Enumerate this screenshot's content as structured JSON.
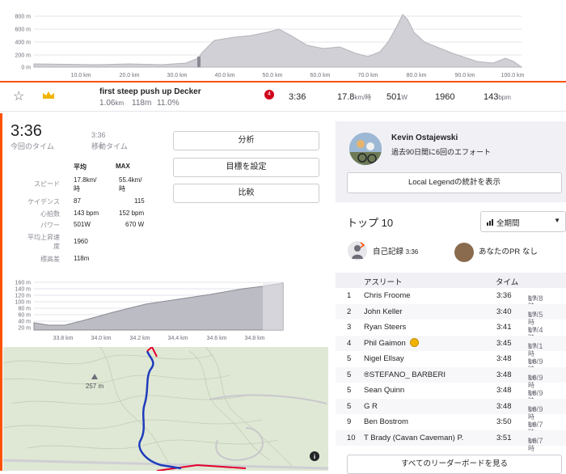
{
  "elevation_chart": {
    "y_ticks": [
      "800 m",
      "600 m",
      "400 m",
      "200 m",
      "0 m"
    ],
    "x_ticks": [
      "10.0 km",
      "20.0 km",
      "30.0 km",
      "40.0 km",
      "50.0 km",
      "60.0 km",
      "70.0 km",
      "80.0 km",
      "90.0 km",
      "100.0 km"
    ]
  },
  "segment": {
    "name": "first steep push up Decker",
    "distance": "1.06",
    "distance_unit": "km",
    "elev_gain": "118m",
    "grade": "11.0%",
    "badge": "4",
    "time": "3:36",
    "speed": "17.8",
    "speed_unit": "km/時",
    "power": "501",
    "power_unit": "W",
    "cadence": "1960",
    "heart_rate": "143",
    "heart_rate_unit": "bpm"
  },
  "effort": {
    "elapsed_time": "3:36",
    "elapsed_label": "今回のタイム",
    "moving_time": "3:36",
    "moving_label": "移動タイム",
    "buttons": [
      "分析",
      "目標を設定",
      "比較"
    ],
    "col_avg": "平均",
    "col_max": "MAX",
    "stats": [
      {
        "label": "スピード",
        "avg": "17.8km/ 時",
        "max": "55.4km/ 時"
      },
      {
        "label": "ケイデンス",
        "avg": "87",
        "max": "115"
      },
      {
        "label": "心拍数",
        "avg": "143 bpm",
        "max": "152 bpm"
      },
      {
        "label": "パワー",
        "avg": "501W",
        "max": "670 W"
      },
      {
        "label": "平均上昇速度",
        "avg": "1960",
        "max": ""
      },
      {
        "label": "標高差",
        "avg": "118m",
        "max": ""
      }
    ]
  },
  "profile_chart": {
    "y_ticks": [
      "160 m",
      "140 m",
      "120 m",
      "100 m",
      "80 m",
      "60 m",
      "40 m",
      "20 m"
    ],
    "x_ticks": [
      "33.8 km",
      "34.0 km",
      "34.2 km",
      "34.4 km",
      "34.6 km",
      "34.8 km"
    ]
  },
  "map": {
    "peak_label": "257 m",
    "info_icon": "i"
  },
  "local_legend": {
    "name": "Kevin Ostajewski",
    "text": "過去90日間に6回のエフォート",
    "button": "Local Legendの統計を表示"
  },
  "leaderboard": {
    "title": "トップ 10",
    "filter": "全期間",
    "pr_label": "自己記録",
    "pr_value": "3:36",
    "your_pr_label": "あなたのPR なし",
    "col_athlete": "アスリート",
    "col_time": "タイム",
    "rows": [
      {
        "rank": "1",
        "name": "Chris Froome",
        "time": "3:36",
        "speed": "17.8",
        "unit": "km/時"
      },
      {
        "rank": "2",
        "name": "John Keller",
        "time": "3:40",
        "speed": "17.5",
        "unit": "km/時"
      },
      {
        "rank": "3",
        "name": "Ryan Steers",
        "time": "3:41",
        "speed": "17.4",
        "unit": "km/時"
      },
      {
        "rank": "4",
        "name": "Phil Gaimon",
        "time": "3:45",
        "speed": "17.1",
        "unit": "km/時"
      },
      {
        "rank": "5",
        "name": "Nigel Ellsay",
        "time": "3:48",
        "speed": "16.9",
        "unit": "km/時"
      },
      {
        "rank": "5",
        "name": "®STEFANO_ BARBERI",
        "time": "3:48",
        "speed": "16.9",
        "unit": "km/時"
      },
      {
        "rank": "5",
        "name": "Sean Quinn",
        "time": "3:48",
        "speed": "16.9",
        "unit": "km/時"
      },
      {
        "rank": "5",
        "name": "G R",
        "time": "3:48",
        "speed": "16.9",
        "unit": "km/時"
      },
      {
        "rank": "9",
        "name": "Ben Bostrom",
        "time": "3:50",
        "speed": "16.7",
        "unit": "km/時"
      },
      {
        "rank": "10",
        "name": "T Brady (Cavan Caveman) P.",
        "time": "3:51",
        "speed": "16.7",
        "unit": "km/時"
      }
    ],
    "view_all": "すべてのリーダーボードを見る"
  }
}
